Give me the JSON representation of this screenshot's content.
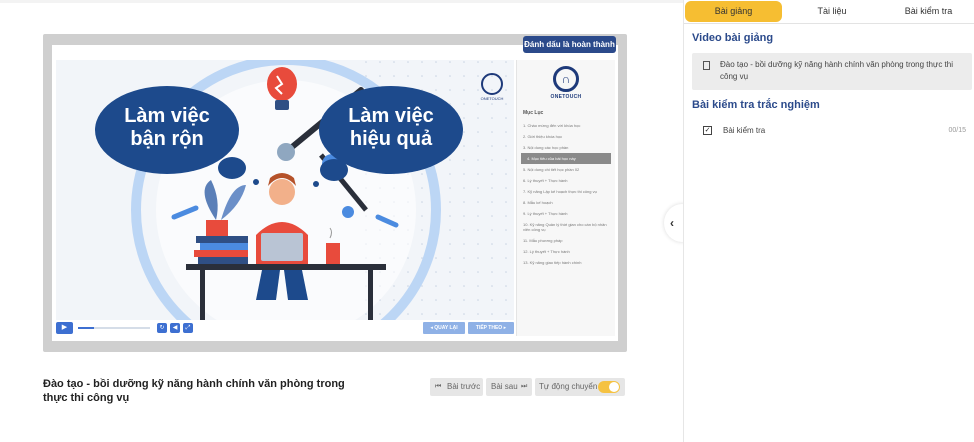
{
  "player": {
    "mark_done_label": "Đánh dấu là hoàn thành",
    "slide": {
      "bubble_left": [
        "Làm việc",
        "bận rộn"
      ],
      "bubble_right": [
        "Làm việc",
        "hiệu quả"
      ],
      "logo_text": "ONETOUCH"
    },
    "toc": {
      "brand": "ONETOUCH",
      "heading": "Mục Lục",
      "items": [
        "1. Chào mừng đến với khóa học",
        "2. Giới thiệu khóa học",
        "3. Nội dung các học phần",
        "4. Mục tiêu của bài học này",
        "5. Nội dung chi tiết học phần 02",
        "6. Lý thuyết + Thực hành",
        "7. Kỹ năng Lập kế hoạch thực thi công vụ",
        "8. Mẫu kế hoạch",
        "9. Lý thuyết + Thực hành",
        "10. Kỹ năng Quản lý thời gian cho cán bộ nhân viên công vụ",
        "11. Mẫu phương pháp",
        "12. Lý thuyết + Thực hành",
        "13. Kỹ năng giao tiếp hành chính"
      ],
      "active_index": 3
    },
    "controls": {
      "progress_fraction": 0.22,
      "prev_label": "◂ QUAY LẠI",
      "next_label": "TIẾP THEO ▸"
    }
  },
  "lesson": {
    "title": "Đào tạo - bồi dưỡng kỹ năng hành chính văn phòng trong thực thi công vụ",
    "prev_button": "Bài trước",
    "next_button": "Bài sau",
    "autoplay_label": "Tự động chuyển",
    "autoplay_on": true
  },
  "sidebar": {
    "tabs": [
      "Bài giảng",
      "Tài liệu",
      "Bài kiểm tra"
    ],
    "active_tab": 0,
    "video_section_title": "Video bài giảng",
    "video_item": "Đào tạo - bồi dưỡng kỹ năng hành chính văn phòng trong thực thi công vụ",
    "quiz_section_title": "Bài kiểm tra trắc nghiệm",
    "quiz_item": "Bài kiểm tra",
    "quiz_score": "00/15"
  },
  "colors": {
    "accent_blue": "#2b4a8b",
    "tab_active": "#f6be32",
    "slide_bubble": "#1d4a8c"
  }
}
